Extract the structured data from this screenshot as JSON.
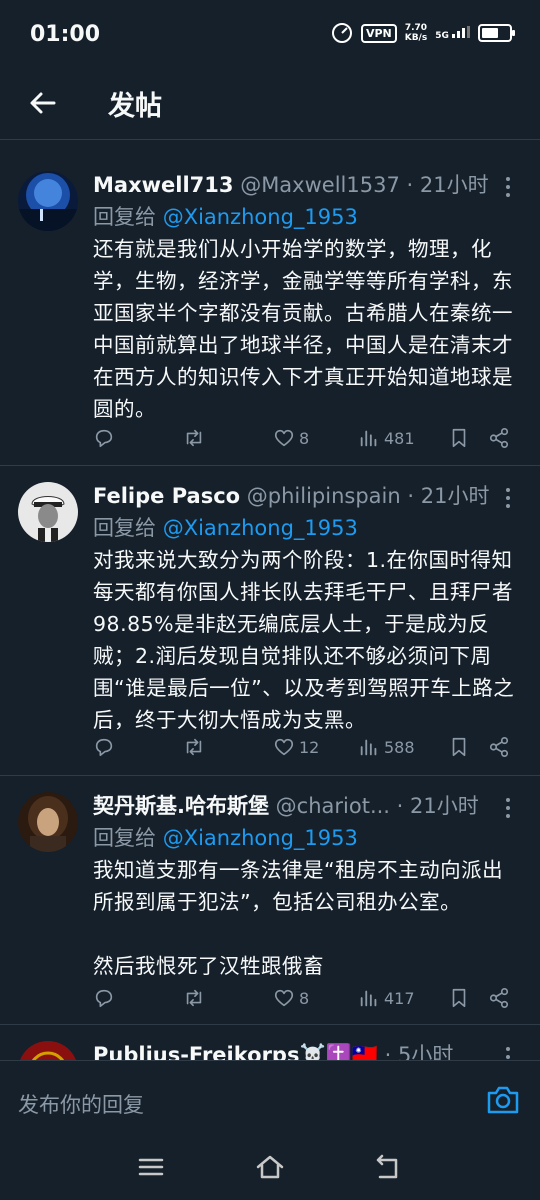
{
  "status": {
    "time": "01:00",
    "vpn": "VPN",
    "net_speed": "7.70",
    "net_unit": "KB/s",
    "signal": "5G"
  },
  "header": {
    "title": "发帖"
  },
  "tweets": [
    {
      "name": "Maxwell713",
      "handle": "@Maxwell1537",
      "dot": "·",
      "time": "21小时",
      "reply_prefix": "回复给",
      "reply_mention": "@Xianzhong_1953",
      "body": "还有就是我们从小开始学的数学，物理，化学，生物，经济学，金融学等等所有学科，东亚国家半个字都没有贡献。古希腊人在秦统一中国前就算出了地球半径，中国人是在清末才在西方人的知识传入下才真正开始知道地球是圆的。",
      "likes": "8",
      "views": "481"
    },
    {
      "name": "Felipe Pasco",
      "handle": "@philipinspain",
      "dot": "·",
      "time": "21小时",
      "reply_prefix": "回复给",
      "reply_mention": "@Xianzhong_1953",
      "body": "对我来说大致分为两个阶段：1.在你国时得知每天都有你国人排长队去拜毛干尸、且拜尸者98.85%是非赵无编底层人士，于是成为反贼；2.润后发现自觉排队还不够必须问下周围“谁是最后一位”、以及考到驾照开车上路之后，终于大彻大悟成为支黑。",
      "likes": "12",
      "views": "588"
    },
    {
      "name": "契丹斯基.哈布斯堡",
      "handle": "@chariot...",
      "dot": "·",
      "time": "21小时",
      "reply_prefix": "回复给",
      "reply_mention": "@Xianzhong_1953",
      "body": "我知道支那有一条法律是“租房不主动向派出所报到属于犯法”，包括公司租办公室。\n\n然后我恨死了汉牲跟俄畜",
      "likes": "8",
      "views": "417"
    },
    {
      "name": "Publius-Freikorps☠️✝️🇹🇼",
      "handle": "",
      "dot": "·",
      "time": "5小时"
    }
  ],
  "composer": {
    "placeholder": "发布你的回复"
  },
  "colors": {
    "background": "#15202b",
    "accent": "#1d9bf0",
    "muted": "#8b98a5",
    "text": "#f7f9f9",
    "divider": "#2f3b47"
  },
  "icons": [
    "back-arrow-icon",
    "reply-icon",
    "retweet-icon",
    "like-icon",
    "views-icon",
    "bookmark-icon",
    "share-icon",
    "more-icon",
    "camera-icon",
    "menu-icon",
    "home-icon",
    "return-icon"
  ]
}
